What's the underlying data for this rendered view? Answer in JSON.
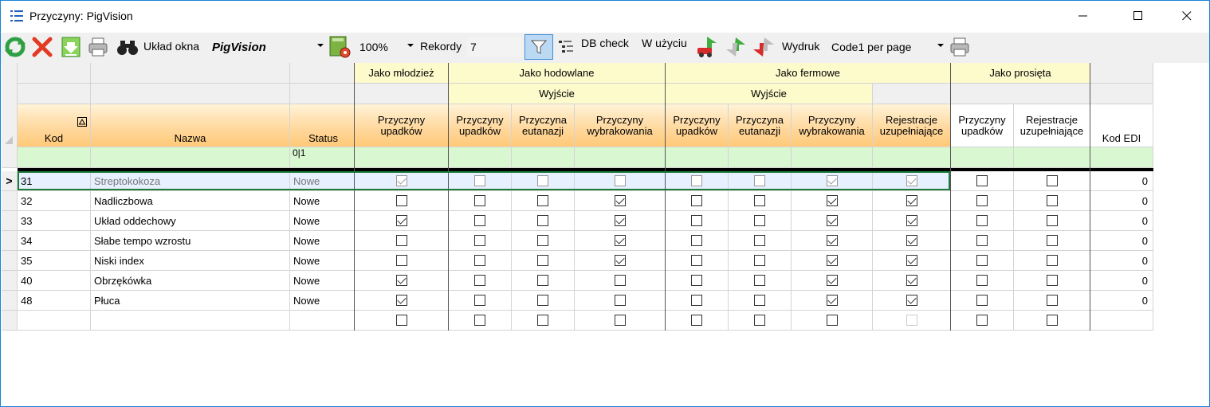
{
  "window": {
    "title": "Przyczyny: PigVision",
    "minimize": "—",
    "maximize": "☐",
    "close": "✕"
  },
  "toolbar": {
    "layout_label": "Układ okna",
    "layout_value": "PigVision",
    "zoom_value": "100%",
    "records_label": "Rekordy",
    "records_value": "7",
    "dbcheck_label": "DB check",
    "inuse_label": "W użyciu",
    "print_label": "Wydruk",
    "print_value": "Code1 per page"
  },
  "bands": {
    "mlodziez": "Jako młodzież",
    "hodowlane": "Jako hodowlane",
    "fermowe": "Jako fermowe",
    "prosieta": "Jako prosięta",
    "wyjscie": "Wyjście"
  },
  "columns": {
    "kod": "Kod",
    "nazwa": "Nazwa",
    "status": "Status",
    "m_upadkow_1": "Przyczyny",
    "m_upadkow_2": "upadków",
    "h_upadkow_1": "Przyczyny",
    "h_upadkow_2": "upadków",
    "h_eutanazji_1": "Przyczyna",
    "h_eutanazji_2": "eutanazji",
    "h_wybrak_1": "Przyczyny",
    "h_wybrak_2": "wybrakowania",
    "f_upadkow_1": "Przyczyny",
    "f_upadkow_2": "upadków",
    "f_eutanazji_1": "Przyczyna",
    "f_eutanazji_2": "eutanazji",
    "f_wybrak_1": "Przyczyny",
    "f_wybrak_2": "wybrakowania",
    "f_rejestr_1": "Rejestracje",
    "f_rejestr_2": "uzupełniające",
    "p_upadkow_1": "Przyczyny",
    "p_upadkow_2": "upadków",
    "p_rejestr_1": "Rejestracje",
    "p_rejestr_2": "uzupełniające",
    "kod_edi": "Kod EDI"
  },
  "filter": {
    "status": "0|1"
  },
  "current_row_marker": ">",
  "rows": [
    {
      "kod": "31",
      "nazwa": "Streptokokoza",
      "status": "Nowe",
      "checks": [
        true,
        false,
        false,
        false,
        false,
        false,
        true,
        true,
        false,
        false
      ],
      "kod_edi": "0"
    },
    {
      "kod": "32",
      "nazwa": "Nadliczbowa",
      "status": "Nowe",
      "checks": [
        false,
        false,
        false,
        true,
        false,
        false,
        true,
        true,
        false,
        false
      ],
      "kod_edi": "0"
    },
    {
      "kod": "33",
      "nazwa": "Układ oddechowy",
      "status": "Nowe",
      "checks": [
        true,
        false,
        false,
        true,
        false,
        false,
        true,
        true,
        false,
        false
      ],
      "kod_edi": "0"
    },
    {
      "kod": "34",
      "nazwa": "Słabe tempo wzrostu",
      "status": "Nowe",
      "checks": [
        false,
        false,
        false,
        true,
        false,
        false,
        true,
        true,
        false,
        false
      ],
      "kod_edi": "0"
    },
    {
      "kod": "35",
      "nazwa": "Niski index",
      "status": "Nowe",
      "checks": [
        false,
        false,
        false,
        true,
        false,
        false,
        true,
        true,
        false,
        false
      ],
      "kod_edi": "0"
    },
    {
      "kod": "40",
      "nazwa": "Obrzękówka",
      "status": "Nowe",
      "checks": [
        true,
        false,
        false,
        false,
        false,
        false,
        true,
        true,
        false,
        false
      ],
      "kod_edi": "0"
    },
    {
      "kod": "48",
      "nazwa": "Płuca",
      "status": "Nowe",
      "checks": [
        true,
        false,
        false,
        false,
        false,
        false,
        true,
        true,
        false,
        false
      ],
      "kod_edi": "0"
    }
  ]
}
